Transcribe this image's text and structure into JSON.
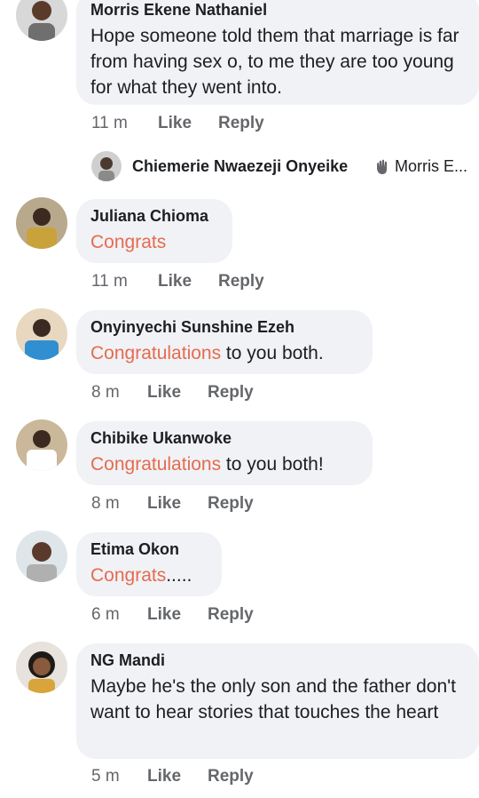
{
  "comments": [
    {
      "author": "Morris Ekene Nathaniel",
      "text_plain": "Hope someone told them that marriage is far from having sex o, to me they are too young for what they went into.",
      "time": "11 m",
      "like": "Like",
      "reply": "Reply"
    },
    {
      "author": "Juliana Chioma",
      "text_highlight": "Congrats",
      "text_rest": "",
      "time": "11 m",
      "like": "Like",
      "reply": "Reply"
    },
    {
      "author": "Onyinyechi Sunshine Ezeh",
      "text_highlight": "Congratulations",
      "text_rest": " to you both.",
      "time": "8 m",
      "like": "Like",
      "reply": "Reply"
    },
    {
      "author": "Chibike Ukanwoke",
      "text_highlight": "Congratulations",
      "text_rest": " to you both!",
      "time": "8 m",
      "like": "Like",
      "reply": "Reply"
    },
    {
      "author": "Etima Okon",
      "text_highlight": "Congrats",
      "text_rest": ".....",
      "time": "6 m",
      "like": "Like",
      "reply": "Reply"
    },
    {
      "author": "NG Mandi",
      "text_plain": "Maybe he's the only son and the father don't want to hear stories that touches the heart",
      "time": "5 m",
      "like": "Like",
      "reply": "Reply"
    }
  ],
  "reply_preview": {
    "author": "Chiemerie Nwaezeji Onyeike",
    "icon": "reply-hand-icon",
    "replying_to": "Morris E..."
  },
  "colors": {
    "bubble": "#f0f2f5",
    "highlight": "#e66a50",
    "meta": "#65676b",
    "text": "#1c1e21"
  }
}
